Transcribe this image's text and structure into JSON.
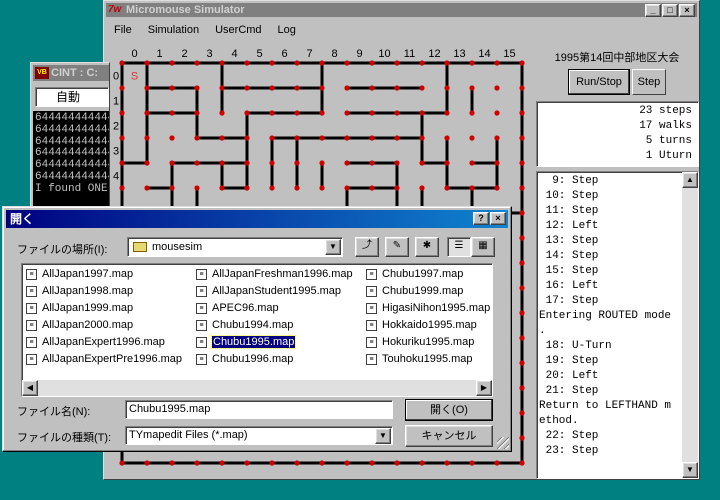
{
  "simulator": {
    "title": "Micromouse Simulator",
    "app_icon_text": "7w",
    "menu": [
      "File",
      "Simulation",
      "UserCmd",
      "Log"
    ],
    "maze": {
      "columns": [
        "0",
        "1",
        "2",
        "3",
        "4",
        "5",
        "6",
        "7",
        "8",
        "9",
        "10",
        "11",
        "12",
        "13",
        "14",
        "15"
      ],
      "rows": [
        "0",
        "1",
        "2",
        "3",
        "4"
      ],
      "start_marker": "S"
    },
    "contest_title": "1995第14回中部地区大会",
    "run_stop_label": "Run/Stop",
    "step_label": "Step",
    "stats": [
      "23 steps",
      "17 walks",
      "5 turns",
      "1 Uturn"
    ],
    "log_lines": [
      "  9: Step",
      " 10: Step",
      " 11: Step",
      " 12: Left",
      " 13: Step",
      " 14: Step",
      " 15: Step",
      " 16: Left",
      " 17: Step",
      "Entering ROUTED mode",
      ".",
      " 18: U-Turn",
      " 19: Step",
      " 20: Left",
      " 21: Step",
      "Return to LEFTHAND m",
      "ethod.",
      " 22: Step",
      " 23: Step"
    ]
  },
  "cint": {
    "title": "CINT : C:",
    "icon_text": "VB",
    "mode": "自動",
    "console_lines": [
      "644444444444",
      "644444444444",
      "644444444444",
      "644444444444",
      "644444444444",
      "644444444444",
      "I found ONE"
    ]
  },
  "dialog": {
    "title": "開く",
    "look_in_label": "ファイルの場所(I):",
    "look_in_value": "mousesim",
    "files": [
      [
        "AllJapan1997.map",
        "AllJapan1998.map",
        "AllJapan1999.map",
        "AllJapan2000.map",
        "AllJapanExpert1996.map",
        "AllJapanExpertPre1996.map"
      ],
      [
        "AllJapanFreshman1996.map",
        "AllJapanStudent1995.map",
        "APEC96.map",
        "Chubu1994.map",
        "Chubu1995.map",
        "Chubu1996.map"
      ],
      [
        "Chubu1997.map",
        "Chubu1999.map",
        "HigasiNihon1995.map",
        "Hokkaido1995.map",
        "Hokuriku1995.map",
        "Touhoku1995.map"
      ]
    ],
    "selected_file": "Chubu1995.map",
    "filename_label": "ファイル名(N):",
    "filename_value": "Chubu1995.map",
    "filetype_label": "ファイルの種類(T):",
    "filetype_value": "TYmapedit Files (*.map)",
    "open_label": "開く(O)",
    "cancel_label": "キャンセル"
  }
}
